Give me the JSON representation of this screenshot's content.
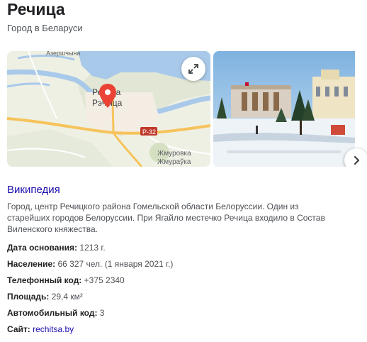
{
  "entity": {
    "title": "Речица",
    "subtitle": "Город в Беларуси"
  },
  "map": {
    "labels": {
      "village_top": "Азершчына",
      "city_ru": "Речица",
      "city_by": "Рэчыца",
      "road": "Р-32",
      "district_ru": "Жмуровка",
      "district_by": "Жмураўка"
    },
    "expand_icon": "expand-icon",
    "pin_icon": "location-pin-icon"
  },
  "photo": {
    "next_icon": "chevron-right-icon"
  },
  "wiki": {
    "source_label": "Википедия",
    "description": "Город, центр Речицкого района Гомельской области Белоруссии. Один из старейших городов Белоруссии. При Ягайло местечко Речица входило в Состав Виленского княжества."
  },
  "facts": [
    {
      "key": "Дата основания:",
      "value": "1213 г.",
      "is_link": false
    },
    {
      "key": "Население:",
      "value": "66 327 чел. (1 января 2021 г.)",
      "is_link": false
    },
    {
      "key": "Телефонный код:",
      "value": "+375 2340",
      "is_link": false
    },
    {
      "key": "Площадь:",
      "value": "29,4 км²",
      "is_link": false
    },
    {
      "key": "Автомобильный код:",
      "value": "3",
      "is_link": false
    },
    {
      "key": "Сайт:",
      "value": "rechitsa.by",
      "is_link": true
    }
  ],
  "colors": {
    "link": "#1a0dab",
    "pin": "#ea4335",
    "river": "#a9c9ea",
    "road": "#f6c35b"
  }
}
